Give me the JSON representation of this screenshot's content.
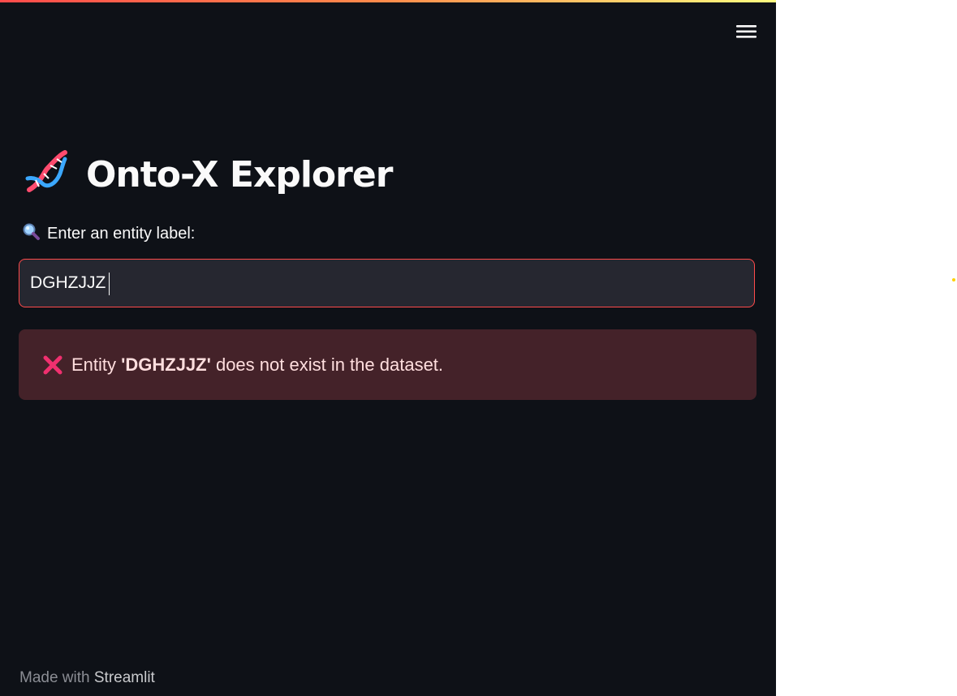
{
  "app": {
    "title": "Onto-X Explorer",
    "title_icon": "dna-icon",
    "menu_icon": "hamburger-menu-icon"
  },
  "search": {
    "label": "Enter an entity label:",
    "label_icon": "magnifying-glass-icon",
    "value": "DGHZJJZ"
  },
  "alert": {
    "icon": "cross-mark-icon",
    "prefix": "Entity ",
    "entity": "'DGHZJJZ'",
    "suffix": " does not exist in the dataset."
  },
  "footer": {
    "made_with": "Made with ",
    "brand": "Streamlit"
  },
  "colors": {
    "background": "#0e1117",
    "accent": "#ff4b4b",
    "input_background": "#262730",
    "error_background": "#442229",
    "error_text": "#ffdede",
    "status_dot": "#ffd000"
  }
}
